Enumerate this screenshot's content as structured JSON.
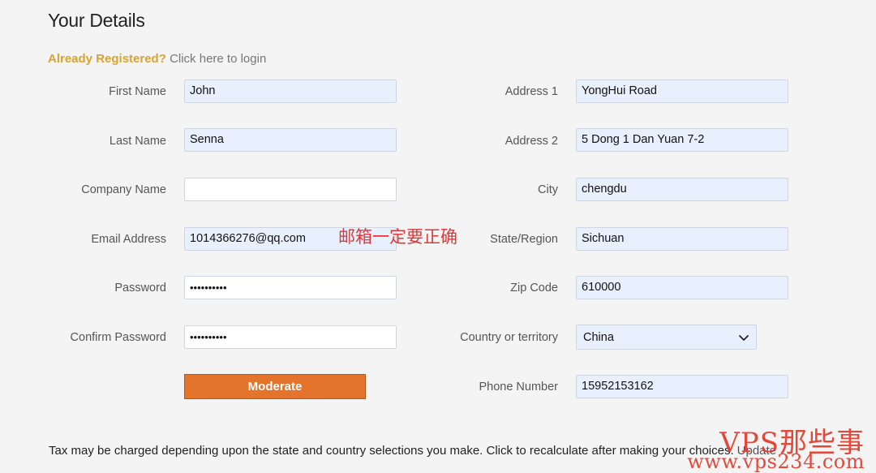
{
  "page": {
    "title": "Your Details",
    "already_registered": "Already Registered?",
    "login_link": "Click here to login"
  },
  "form": {
    "left": [
      {
        "label": "First Name",
        "value": "John"
      },
      {
        "label": "Last Name",
        "value": "Senna"
      },
      {
        "label": "Company Name",
        "value": ""
      },
      {
        "label": "Email Address",
        "value": "1014366276@qq.com"
      },
      {
        "label": "Password",
        "value": "••••••••••"
      },
      {
        "label": "Confirm Password",
        "value": "••••••••••"
      }
    ],
    "right": [
      {
        "label": "Address 1",
        "value": "YongHui Road"
      },
      {
        "label": "Address 2",
        "value": "5 Dong 1 Dan Yuan 7-2"
      },
      {
        "label": "City",
        "value": "chengdu"
      },
      {
        "label": "State/Region",
        "value": "Sichuan"
      },
      {
        "label": "Zip Code",
        "value": "610000"
      },
      {
        "label": "Country or territory",
        "value": "China"
      },
      {
        "label": "Phone Number",
        "value": "15952153162"
      }
    ],
    "submit_label": "Moderate"
  },
  "annotation": {
    "text": "邮箱一定要正确",
    "color": "#e0373a"
  },
  "footer": {
    "tax_note": "Tax may be charged depending upon the state and country selections you make. Click to recalculate after making your choices.",
    "update_link": "Update"
  },
  "watermark": {
    "top": "VPS那些事",
    "bottom": "www.vps234.com"
  },
  "colors": {
    "accent": "#d8a433",
    "button": "#e4742b",
    "field_bg": "#e8f0fe"
  }
}
